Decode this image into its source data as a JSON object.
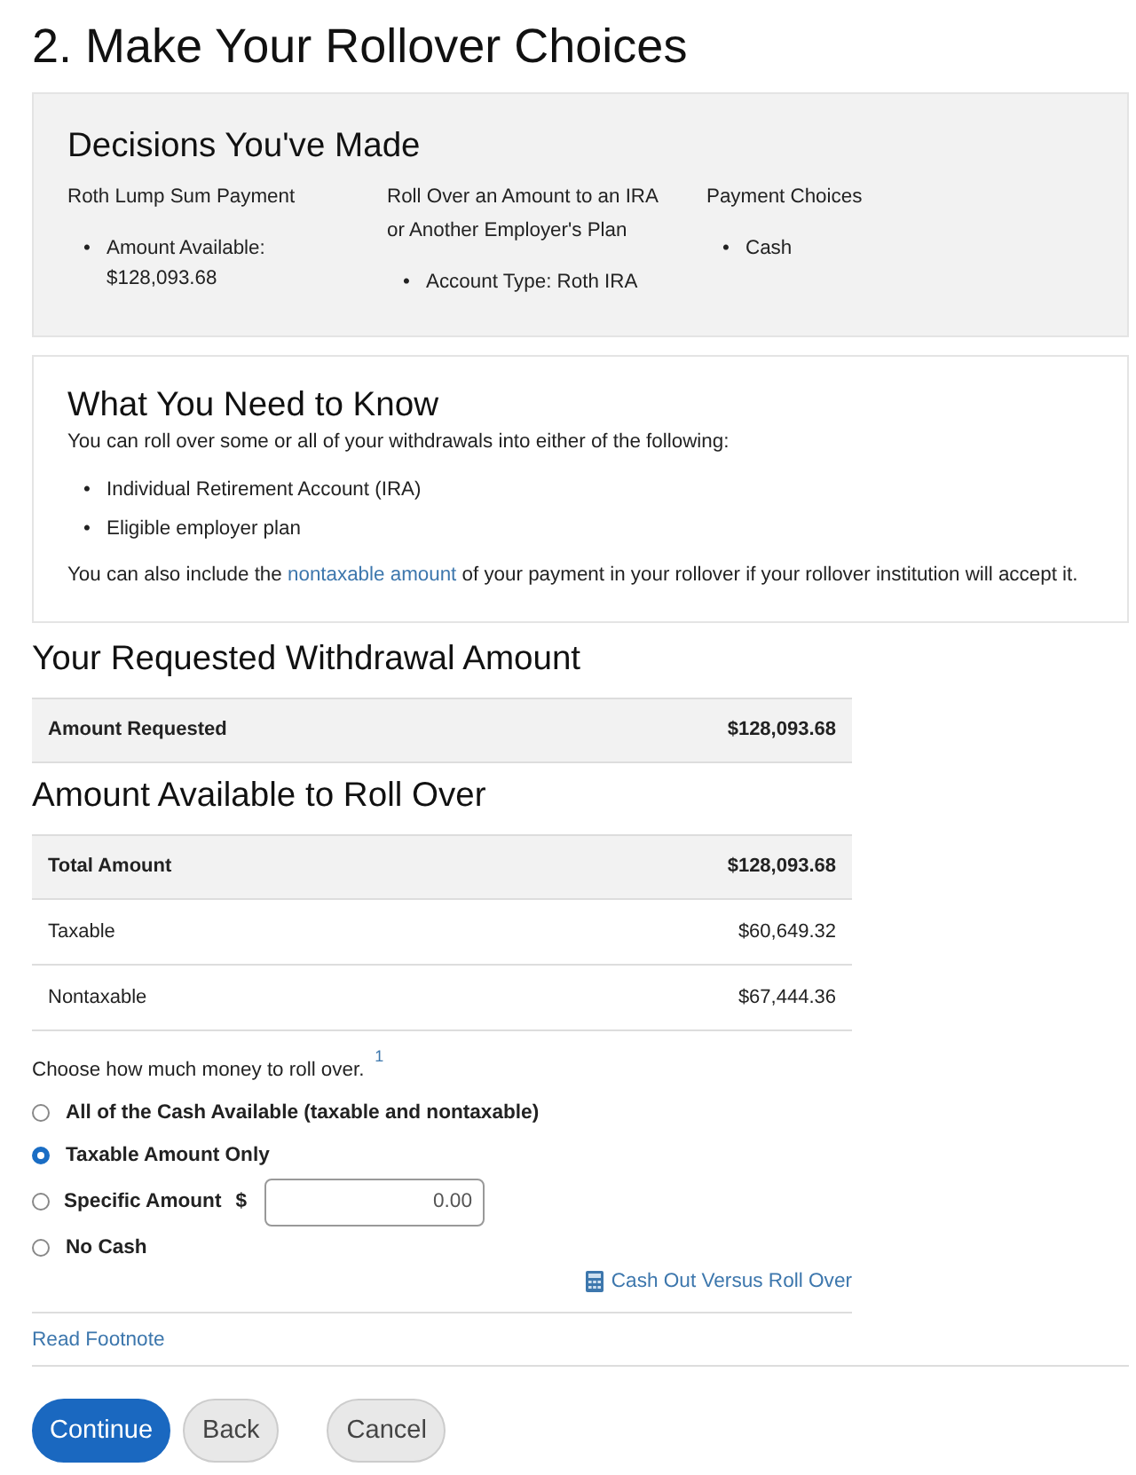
{
  "page_title": "2. Make Your Rollover Choices",
  "decisions": {
    "title": "Decisions You've Made",
    "columns": [
      {
        "heading": "Roth Lump Sum Payment",
        "items": [
          {
            "marker": "•",
            "text": "Amount Available: $128,093.68"
          }
        ]
      },
      {
        "heading": "Roll Over an Amount to an IRA or Another Employer's Plan",
        "items": [
          {
            "marker": "•",
            "text": "Account Type: Roth IRA"
          }
        ]
      },
      {
        "heading": "Payment Choices",
        "items": [
          {
            "marker": "•",
            "text": "Cash"
          }
        ]
      }
    ]
  },
  "need_to_know": {
    "title": "What You Need to Know",
    "intro": "You can roll over some or all of your withdrawals into either of the following:",
    "items": [
      {
        "marker": "•",
        "text": "Individual Retirement Account (IRA)"
      },
      {
        "marker": "•",
        "text": "Eligible employer plan"
      }
    ],
    "note": {
      "before": "You can also include the ",
      "link": "nontaxable amount",
      "after": " of your payment in your rollover if your rollover institution will accept it."
    }
  },
  "withdrawal": {
    "title": "Your Requested Withdrawal Amount",
    "rows": [
      {
        "kind": "total",
        "label": "Amount Requested",
        "amount": "$128,093.68"
      }
    ]
  },
  "available": {
    "title": "Amount Available to Roll Over",
    "rows": [
      {
        "kind": "total",
        "label": "Total Amount",
        "amount": "$128,093.68"
      },
      {
        "kind": "detail",
        "label": "Taxable",
        "amount": "$60,649.32"
      },
      {
        "kind": "detail",
        "label": "Nontaxable",
        "amount": "$67,444.36"
      }
    ]
  },
  "rollover_choice": {
    "prompt": "Choose how much money to roll over.",
    "footnote_mark": "1",
    "options": [
      {
        "kind": "plain",
        "label": "All of the Cash Available (taxable and nontaxable)",
        "selected": false
      },
      {
        "kind": "plain",
        "label": "Taxable Amount Only",
        "selected": true
      },
      {
        "kind": "amount",
        "label": "Specific Amount",
        "currency": "$",
        "value": "0.00",
        "selected": false
      },
      {
        "kind": "plain",
        "label": "No Cash",
        "selected": false
      }
    ],
    "tool_link": "Cash Out Versus Roll Over"
  },
  "footnote_link": "Read Footnote",
  "buttons": [
    {
      "kind": "primary",
      "label": "Continue"
    },
    {
      "kind": "secondary",
      "label": "Back"
    },
    {
      "kind": "secondary",
      "label": "Cancel"
    }
  ]
}
